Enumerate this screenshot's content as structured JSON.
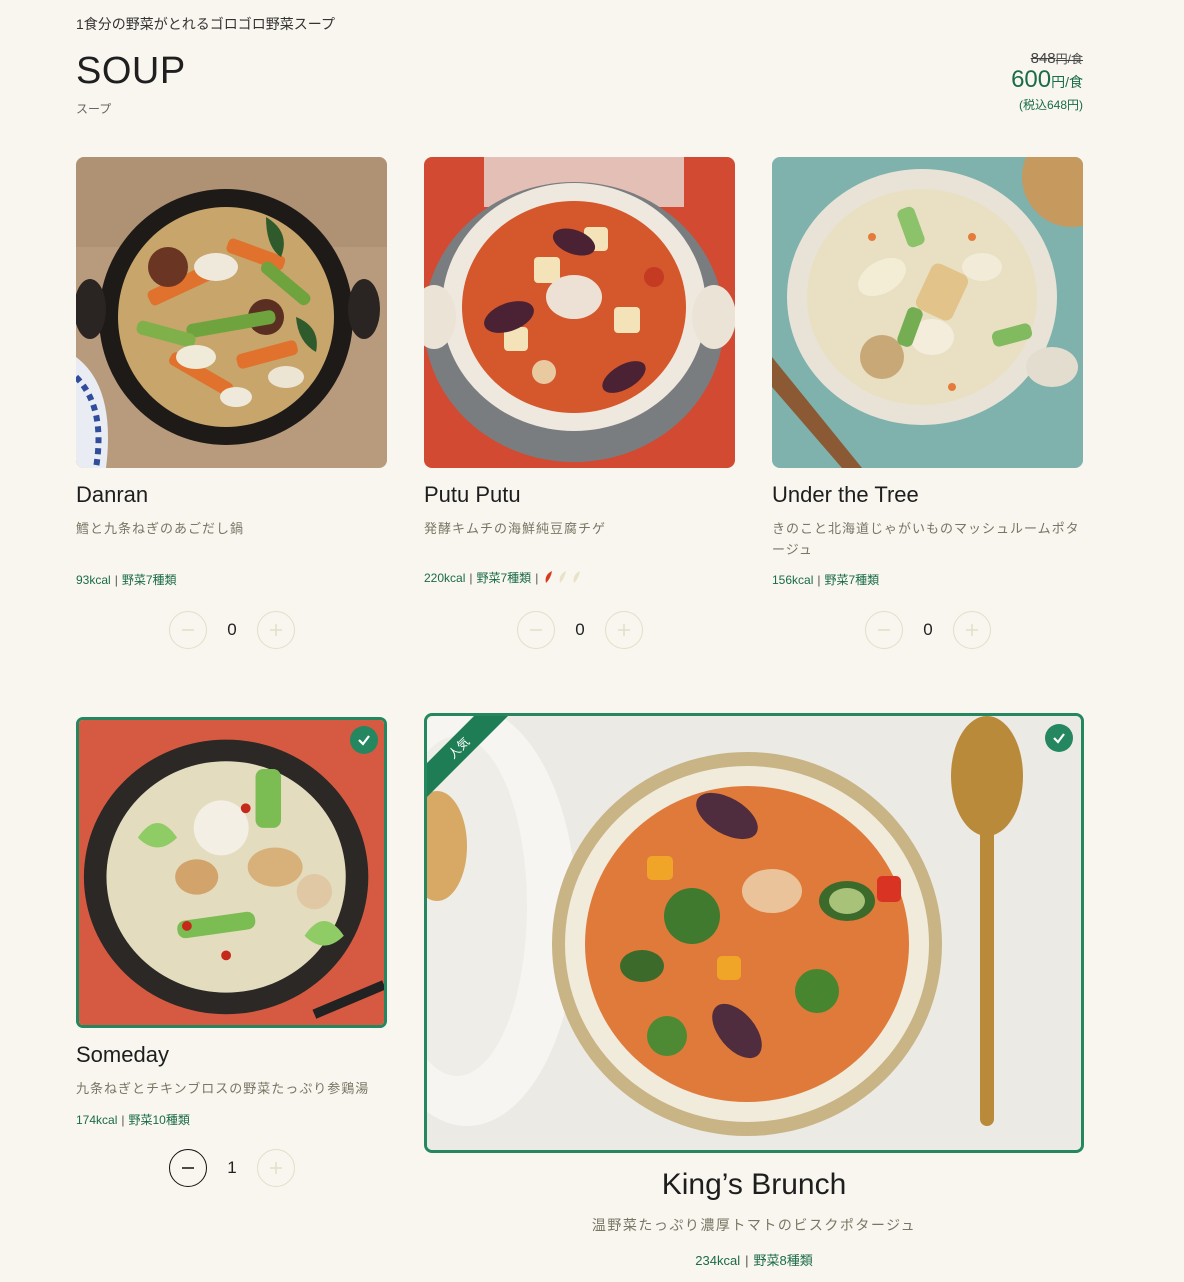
{
  "header": {
    "tagline": "1食分の野菜がとれるゴロゴロ野菜スープ",
    "title": "SOUP",
    "subtitle": "スープ"
  },
  "price": {
    "old_value": "848",
    "old_unit": "円/食",
    "now_value": "600",
    "now_unit": "円/食",
    "tax": "(税込648円)"
  },
  "products": [
    {
      "name": "Danran",
      "desc": "鱈と九条ねぎのあごだし鍋",
      "kcal": "93kcal",
      "veg": "野菜7種類",
      "qty": "0",
      "selected": false
    },
    {
      "name": "Putu Putu",
      "desc": "発酵キムチの海鮮純豆腐チゲ",
      "kcal": "220kcal",
      "veg": "野菜7種類",
      "spice_level": 1,
      "spice_max": 3,
      "qty": "0",
      "selected": false
    },
    {
      "name": "Under the Tree",
      "desc": "きのこと北海道じゃがいものマッシュルームポタージュ",
      "kcal": "156kcal",
      "veg": "野菜7種類",
      "qty": "0",
      "selected": false
    },
    {
      "name": "Someday",
      "desc": "九条ねぎとチキンブロスの野菜たっぷり参鶏湯",
      "kcal": "174kcal",
      "veg": "野菜10種類",
      "qty": "1",
      "selected": true
    }
  ],
  "feature": {
    "badge": "人気",
    "name": "King’s Brunch",
    "desc": "温野菜たっぷり濃厚トマトのビスクポタージュ",
    "kcal": "234kcal",
    "veg": "野菜8種類",
    "selected": true
  },
  "colors": {
    "background": "#f8f6ef",
    "accent": "#24875f",
    "text_green": "#1b6b48"
  }
}
